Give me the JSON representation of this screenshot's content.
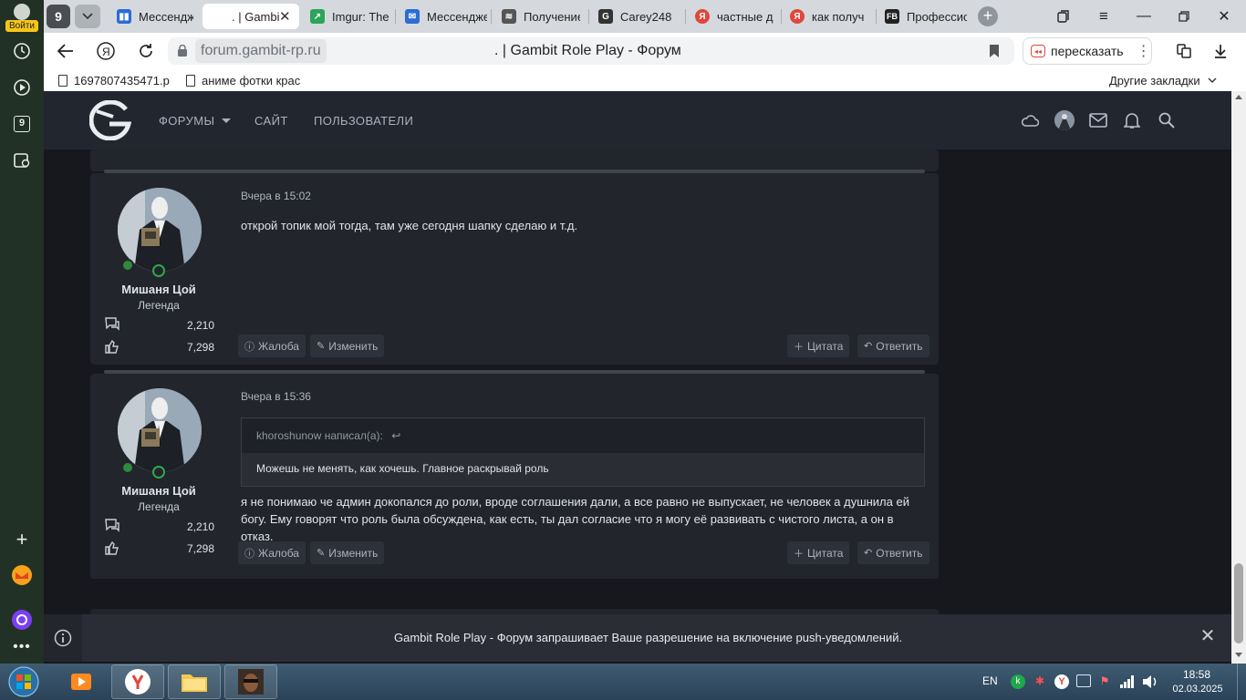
{
  "sidepanel": {
    "login_label": "Войти",
    "items": [
      "history-icon",
      "play-icon",
      "apps-icon",
      "screenshot-icon",
      "plus-icon",
      "mail-icon",
      "alice-icon",
      "more-icon"
    ],
    "badge_9": "9"
  },
  "tabs": {
    "group_badge": "9",
    "items": [
      {
        "label": "Мессенджер",
        "fav_color": "#2b6cd6",
        "fav": "▮▮"
      },
      {
        "label": ". | Gambit",
        "fav_color": "#ffffff",
        "fav": ""
      },
      {
        "label": "Imgur: The",
        "fav_color": "#2aa55a",
        "fav": "↗"
      },
      {
        "label": "Мессенджер",
        "fav_color": "#2b6cd6",
        "fav": "✉"
      },
      {
        "label": "Получение",
        "fav_color": "#555555",
        "fav": "≋"
      },
      {
        "label": "Carey248",
        "fav_color": "#333333",
        "fav": "G"
      },
      {
        "label": "частные д",
        "fav_color": "#e0463b",
        "fav": "Я"
      },
      {
        "label": "как получ",
        "fav_color": "#e0463b",
        "fav": "Я"
      },
      {
        "label": "Профессио",
        "fav_color": "#222222",
        "fav": "FB"
      }
    ]
  },
  "address": {
    "domain": "forum.gambit-rp.ru",
    "page_title": ". | Gambit Role Play - Форум",
    "translate_label": "пересказать"
  },
  "bookmarks": {
    "items": [
      "1697807435471.p",
      "аниме фотки крас"
    ],
    "other_label": "Другие закладки"
  },
  "forum_header": {
    "nav": [
      "ФОРУМЫ",
      "САЙТ",
      "ПОЛЬЗОВАТЕЛИ"
    ]
  },
  "posts": [
    {
      "date": "Вчера в 15:02",
      "author": "Мишаня Цой",
      "user_title": "Легенда",
      "messages": "2,210",
      "reactions": "7,298",
      "text": "открой топик мой тогда, там уже сегодня шапку сделаю и т.д.",
      "actions": {
        "report": "Жалоба",
        "edit": "Изменить",
        "quote": "Цитата",
        "reply": "Ответить"
      }
    },
    {
      "date": "Вчера в 15:36",
      "author": "Мишаня Цой",
      "user_title": "Легенда",
      "messages": "2,210",
      "reactions": "7,298",
      "quote_author": "khoroshunow написал(а):",
      "quote_text": "Можешь не менять, как хочешь. Главное раскрывай роль",
      "text": "я не понимаю че админ докопался до роли, вроде соглашения дали, а все равно не выпускает, не человек а душнила ей богу. Ему говорят что роль была обсуждена, как есть, ты дал согласие что я могу её развивать с чистого листа, а он в отказ.",
      "actions": {
        "report": "Жалоба",
        "edit": "Изменить",
        "quote": "Цитата",
        "reply": "Ответить"
      }
    }
  ],
  "push_banner": {
    "message": "Gambit Role Play - Форум запрашивает Ваше разрешение на включение push-уведомлений."
  },
  "taskbar": {
    "lang": "EN",
    "time": "18:58",
    "date": "02.03.2025"
  },
  "colors": {
    "page_bg": "#16181d",
    "post_bg": "#22252c",
    "header_bg": "#22262e",
    "accent_green": "#2fa84a"
  }
}
